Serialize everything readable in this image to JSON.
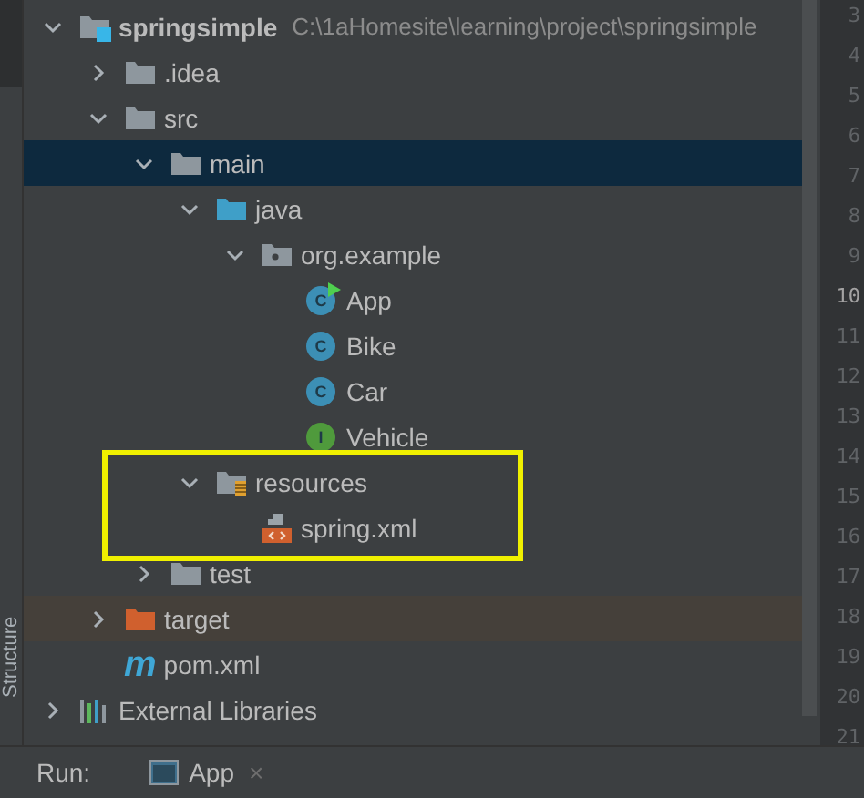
{
  "side_tabs": [
    {
      "label": "Structure",
      "selected": false
    }
  ],
  "tree": [
    {
      "label": "springsimple",
      "path": "C:\\1aHomesite\\learning\\project\\springsimple",
      "kind": "module",
      "expanded": true,
      "selected": false,
      "children": [
        {
          "label": ".idea",
          "kind": "folder",
          "expanded": false,
          "selected": false
        },
        {
          "label": "src",
          "kind": "folder",
          "expanded": true,
          "selected": false,
          "children": [
            {
              "label": "main",
              "kind": "folder",
              "expanded": true,
              "selected": true,
              "children": [
                {
                  "label": "java",
                  "kind": "source-folder",
                  "expanded": true,
                  "selected": false,
                  "children": [
                    {
                      "label": "org.example",
                      "kind": "package",
                      "expanded": true,
                      "selected": false,
                      "children": [
                        {
                          "label": "App",
                          "kind": "class",
                          "icon_letter": "C",
                          "runnable": true,
                          "selected": false
                        },
                        {
                          "label": "Bike",
                          "kind": "class",
                          "icon_letter": "C",
                          "runnable": false,
                          "selected": false
                        },
                        {
                          "label": "Car",
                          "kind": "class",
                          "icon_letter": "C",
                          "runnable": false,
                          "selected": false
                        },
                        {
                          "label": "Vehicle",
                          "kind": "interface",
                          "icon_letter": "I",
                          "runnable": false,
                          "selected": false
                        }
                      ]
                    }
                  ]
                },
                {
                  "label": "resources",
                  "kind": "resource-folder",
                  "expanded": true,
                  "selected": false,
                  "children": [
                    {
                      "label": "spring.xml",
                      "kind": "xml",
                      "selected": false
                    }
                  ]
                }
              ]
            },
            {
              "label": "test",
              "kind": "folder",
              "expanded": false,
              "selected": false
            }
          ]
        },
        {
          "label": "target",
          "kind": "excluded-folder",
          "expanded": false,
          "selected": false
        },
        {
          "label": "pom.xml",
          "kind": "maven",
          "icon_letter": "m",
          "selected": false
        }
      ]
    },
    {
      "label": "External Libraries",
      "kind": "libraries",
      "expanded": false,
      "selected": false
    }
  ],
  "gutter": {
    "lines": [
      {
        "number": "3",
        "current": false
      },
      {
        "number": "4",
        "current": false
      },
      {
        "number": "5",
        "current": false
      },
      {
        "number": "6",
        "current": false
      },
      {
        "number": "7",
        "current": false
      },
      {
        "number": "8",
        "current": false
      },
      {
        "number": "9",
        "current": false
      },
      {
        "number": "10",
        "current": true
      },
      {
        "number": "11",
        "current": false
      },
      {
        "number": "12",
        "current": false
      },
      {
        "number": "13",
        "current": false
      },
      {
        "number": "14",
        "current": false
      },
      {
        "number": "15",
        "current": false
      },
      {
        "number": "16",
        "current": false
      },
      {
        "number": "17",
        "current": false
      },
      {
        "number": "18",
        "current": false
      },
      {
        "number": "19",
        "current": false
      },
      {
        "number": "20",
        "current": false
      },
      {
        "number": "21",
        "current": false
      }
    ]
  },
  "run_bar": {
    "label": "Run:",
    "tabs": [
      {
        "label": "App",
        "close": "×",
        "selected": true
      }
    ]
  }
}
